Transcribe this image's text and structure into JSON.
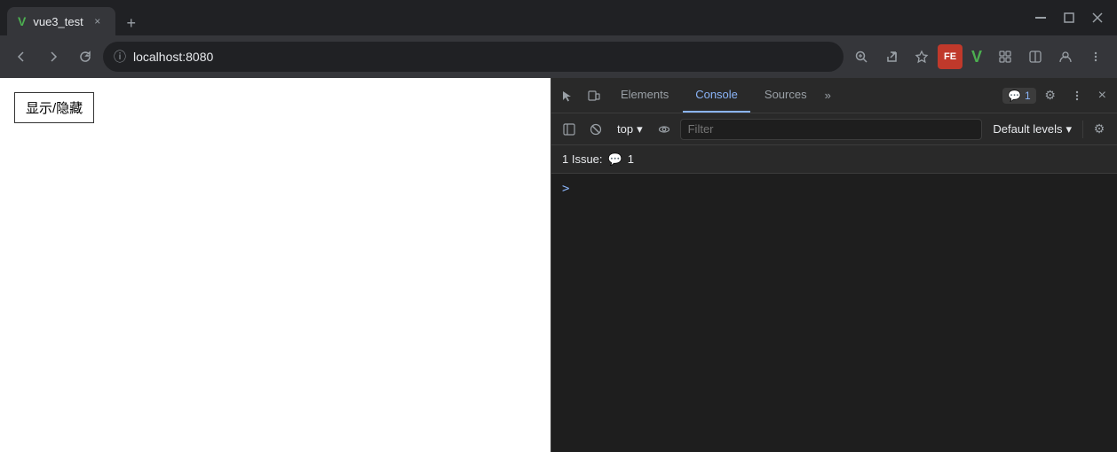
{
  "titlebar": {
    "tab": {
      "icon": "V",
      "label": "vue3_test",
      "close_label": "×"
    },
    "new_tab_label": "+",
    "window_controls": {
      "minimize": "—",
      "maximize": "□",
      "close": "×"
    }
  },
  "navbar": {
    "back_label": "←",
    "forward_label": "→",
    "reload_label": "↻",
    "address": "localhost:8080",
    "info_icon": "ⓘ",
    "zoom_icon": "🔍",
    "share_icon": "↗",
    "bookmark_icon": "☆",
    "extensions_icon": "⊕",
    "sidebar_icon": "▣",
    "profile_icon": "👤",
    "menu_icon": "⋮",
    "ext_fe_label": "FE",
    "ext_vue_label": "V"
  },
  "webpage": {
    "button_label": "显示/隐藏"
  },
  "devtools": {
    "tabs": [
      {
        "label": "Elements",
        "active": false
      },
      {
        "label": "Console",
        "active": true
      },
      {
        "label": "Sources",
        "active": false
      }
    ],
    "more_tabs_label": "»",
    "badge_count": "1",
    "settings_icon": "⚙",
    "more_icon": "⋮",
    "close_icon": "×",
    "console_toolbar": {
      "sidebar_icon": "▣",
      "block_icon": "🚫",
      "context_label": "top",
      "context_arrow": "▾",
      "eye_icon": "👁",
      "filter_placeholder": "Filter",
      "default_levels_label": "Default levels",
      "levels_arrow": "▾",
      "settings_icon": "⚙"
    },
    "issues": {
      "label": "1 Issue:",
      "icon": "💬",
      "count": "1"
    },
    "console_prompt": ">"
  }
}
